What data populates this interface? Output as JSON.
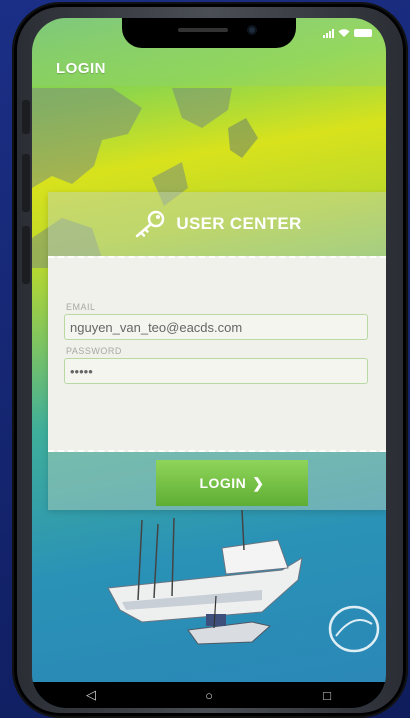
{
  "app": {
    "bar_title": "LOGIN"
  },
  "card": {
    "title": "USER CENTER",
    "email_label": "EMAIL",
    "email_value": "nguyen_van_teo@eacds.com",
    "password_label": "PASSWORD",
    "password_value": "•••••",
    "login_label": "LOGIN",
    "login_chevron": "❯"
  },
  "nav": {
    "back": "◁",
    "home": "○",
    "recents": "□"
  },
  "colors": {
    "accent": "#6cbf3f",
    "field_border": "#b9d8a2"
  },
  "icons": [
    "signal-icon",
    "wifi-icon",
    "battery-icon",
    "key-icon",
    "chevron-right-icon",
    "back-icon",
    "home-icon",
    "recents-icon"
  ]
}
